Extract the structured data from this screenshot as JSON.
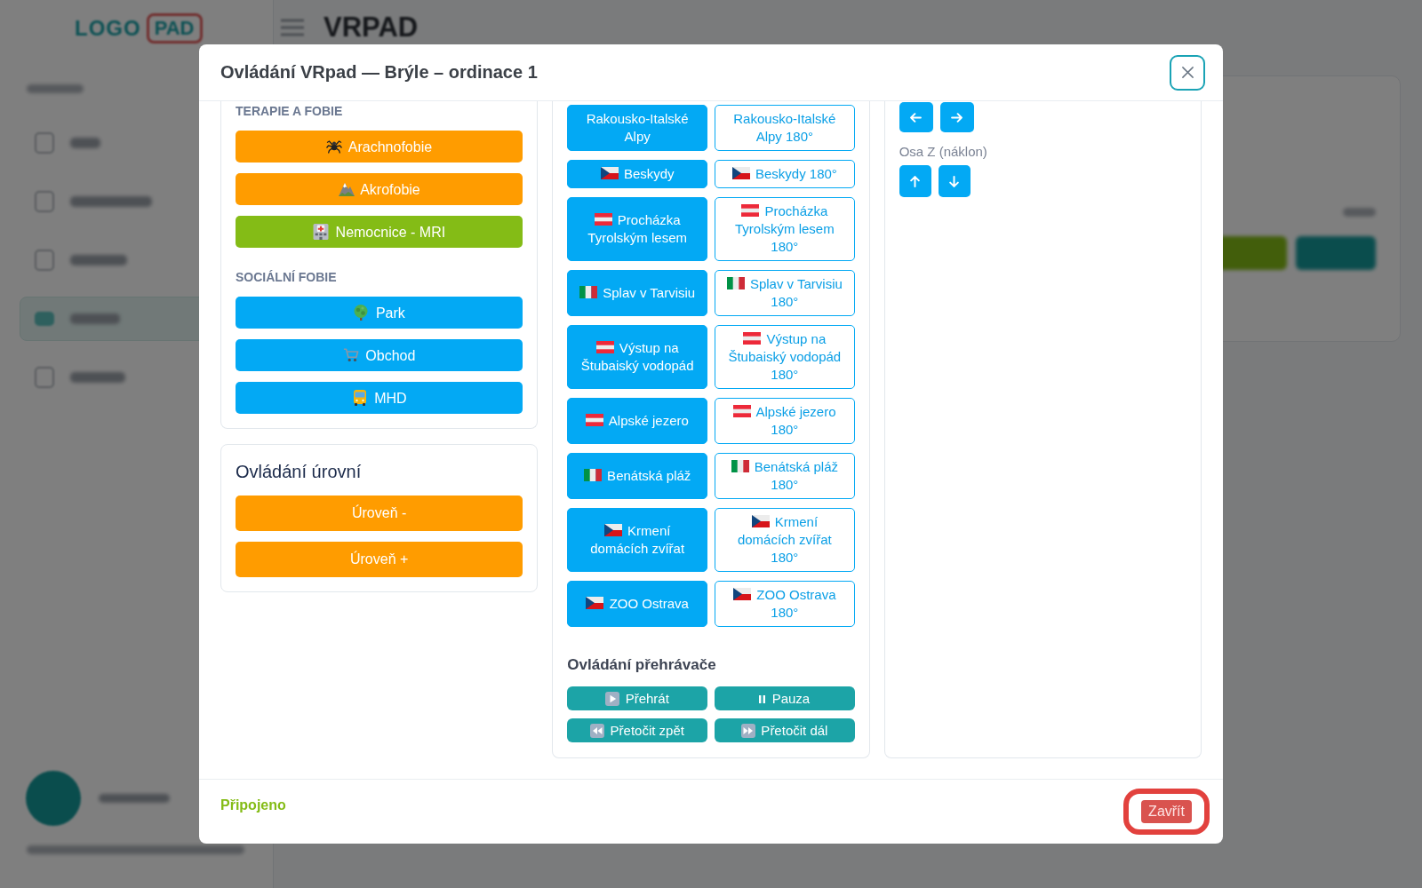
{
  "background": {
    "logo": {
      "text": "LOGO",
      "badge": "PAD"
    },
    "sidebar": {
      "items": [
        {
          "selected": false
        },
        {
          "selected": false
        },
        {
          "selected": false
        },
        {
          "selected": true
        },
        {
          "selected": false
        }
      ]
    },
    "page_title": "VRPAD"
  },
  "modal": {
    "title": "Ovládání VRpad — Brýle – ordinace 1"
  },
  "therapy": {
    "groups": [
      {
        "title": "TERAPIE A FOBIE",
        "buttons": [
          {
            "label": "Arachnofobie",
            "color": "#ff9c00"
          },
          {
            "label": "Akrofobie",
            "color": "#ff9c00"
          },
          {
            "label": "Nemocnice - MRI",
            "color": "#84bc16"
          }
        ]
      },
      {
        "title": "SOCIÁLNÍ FOBIE",
        "buttons": [
          {
            "label": "Park",
            "color": "#03a9f4"
          },
          {
            "label": "Obchod",
            "color": "#03a9f4"
          },
          {
            "label": "MHD",
            "color": "#03a9f4"
          }
        ]
      }
    ]
  },
  "levels": {
    "title": "Ovládání úrovní",
    "buttons": [
      {
        "label": "Úroveň -"
      },
      {
        "label": "Úroveň +"
      }
    ]
  },
  "scenes": {
    "rows": [
      {
        "buttons": [
          {
            "label": "Rakousko-Italské Alpy",
            "kind": "filled"
          },
          {
            "label": "Rakousko-Italské Alpy 180°",
            "kind": "outline"
          }
        ]
      },
      {
        "buttons": [
          {
            "label": "Beskydy",
            "kind": "filled"
          },
          {
            "label": "Beskydy 180°",
            "kind": "outline"
          }
        ]
      },
      {
        "buttons": [
          {
            "label": "Procházka Tyrolským lesem",
            "kind": "filled"
          },
          {
            "label": "Procházka Tyrolským lesem 180°",
            "kind": "outline"
          }
        ]
      },
      {
        "buttons": [
          {
            "label": "Splav v Tarvisiu",
            "kind": "filled"
          },
          {
            "label": "Splav v Tarvisiu 180°",
            "kind": "outline"
          }
        ]
      },
      {
        "buttons": [
          {
            "label": "Výstup na Štubaiský vodopád",
            "kind": "filled"
          },
          {
            "label": "Výstup na Štubaiský vodopád 180°",
            "kind": "outline"
          }
        ]
      },
      {
        "buttons": [
          {
            "label": "Alpské jezero",
            "kind": "filled"
          },
          {
            "label": "Alpské jezero 180°",
            "kind": "outline"
          }
        ]
      },
      {
        "buttons": [
          {
            "label": "Benátská pláž",
            "kind": "filled"
          },
          {
            "label": "Benátská pláž 180°",
            "kind": "outline"
          }
        ]
      },
      {
        "buttons": [
          {
            "label": "Krmení domácích zvířat",
            "kind": "filled"
          },
          {
            "label": "Krmení domácích zvířat 180°",
            "kind": "outline"
          }
        ]
      },
      {
        "buttons": [
          {
            "label": "ZOO Ostrava",
            "kind": "filled"
          },
          {
            "label": "ZOO Ostrava 180°",
            "kind": "outline"
          }
        ]
      }
    ]
  },
  "player": {
    "title": "Ovládání přehrávače",
    "buttons": [
      {
        "label": "Přehrát"
      },
      {
        "label": "Pauza"
      },
      {
        "label": "Přetočit zpět"
      },
      {
        "label": "Přetočit dál"
      }
    ]
  },
  "axis": {
    "label": "Osa Z (náklon)"
  },
  "footer": {
    "status": "Připojeno",
    "close_button": {
      "label": "Zavřít",
      "focused": true
    }
  }
}
